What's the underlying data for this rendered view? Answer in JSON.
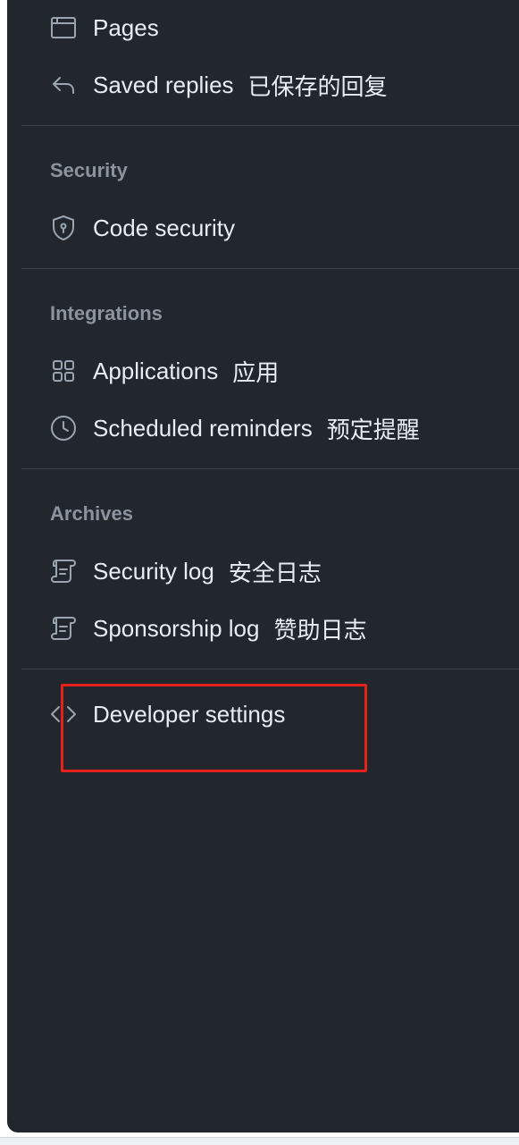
{
  "menu": {
    "pages": {
      "label": "Pages",
      "icon": "browser-icon"
    },
    "saved_replies": {
      "label": "Saved replies",
      "zh": "已保存的回复",
      "icon": "reply-icon"
    },
    "security_section": {
      "title": "Security",
      "code_security": {
        "label": "Code security",
        "icon": "shield-icon"
      }
    },
    "integrations_section": {
      "title": "Integrations",
      "applications": {
        "label": "Applications",
        "zh": "应用",
        "icon": "apps-icon"
      },
      "scheduled_reminders": {
        "label": "Scheduled reminders",
        "zh": "预定提醒",
        "icon": "clock-icon"
      }
    },
    "archives_section": {
      "title": "Archives",
      "security_log": {
        "label": "Security log",
        "zh": "安全日志",
        "icon": "log-icon"
      },
      "sponsorship_log": {
        "label": "Sponsorship log",
        "zh": "赞助日志",
        "icon": "log-icon"
      }
    },
    "developer_settings": {
      "label": "Developer settings",
      "icon": "code-icon"
    }
  },
  "colors": {
    "background": "#22272e",
    "text": "#e6edf3",
    "muted": "#8b949e",
    "highlight": "#e8201a"
  }
}
